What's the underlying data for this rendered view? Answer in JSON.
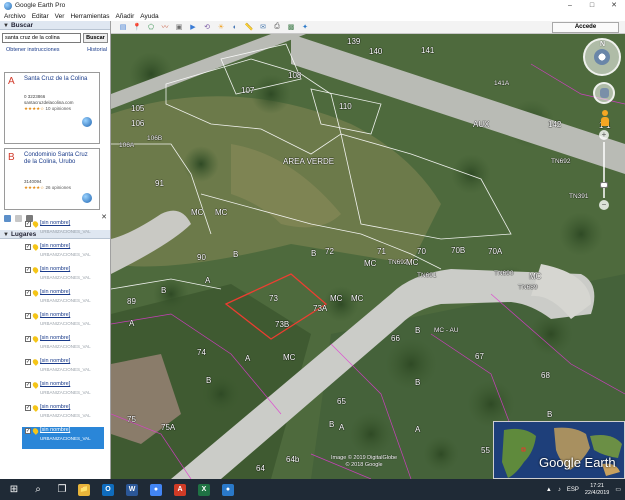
{
  "window": {
    "title": "Google Earth Pro",
    "controls": {
      "minimize": "–",
      "maximize": "□",
      "close": "✕"
    }
  },
  "menu": [
    "Archivo",
    "Editar",
    "Ver",
    "Herramientas",
    "Añadir",
    "Ayuda"
  ],
  "toolbar": {
    "tools": [
      "panel-toggle-icon",
      "placemark-icon",
      "polygon-icon",
      "path-icon",
      "overlay-icon",
      "tour-icon",
      "history-icon",
      "sun-icon",
      "planets-icon",
      "ruler-icon",
      "email-icon",
      "print-icon",
      "save-image-icon",
      "maps-icon"
    ],
    "signin_label": "Accede"
  },
  "search": {
    "section_label": "Buscar",
    "query": "santa cruz de la colina",
    "button_label": "Buscar",
    "directions_label": "Obtener instrucciones",
    "history_label": "Historial",
    "results": [
      {
        "marker": "A",
        "name": "Santa Cruz de la Colina",
        "phone": "0 3223866",
        "site": "santacruzdelacolina.com",
        "stars": "★★★★☆",
        "reviews": "10 opiniones"
      },
      {
        "marker": "B",
        "name": "Condominio Santa Cruz de la Colina, Urubo",
        "phone": "3140094",
        "stars": "★★★★☆",
        "reviews": "26 opiniones"
      }
    ]
  },
  "places": {
    "section_label": "Lugares",
    "items": [
      {
        "name": "[sin nombre]",
        "desc": "URBANIZACIONES_VAL",
        "checked": true
      },
      {
        "name": "[sin nombre]",
        "desc": "URBANIZACIONES_VAL",
        "checked": true
      },
      {
        "name": "[sin nombre]",
        "desc": "URBANIZACIONES_VAL",
        "checked": true
      },
      {
        "name": "[sin nombre]",
        "desc": "URBANIZACIONES_VAL",
        "checked": true
      },
      {
        "name": "[sin nombre]",
        "desc": "URBANIZACIONES_VAL",
        "checked": true
      },
      {
        "name": "[sin nombre]",
        "desc": "URBANIZACIONES_VAL",
        "checked": true
      },
      {
        "name": "[sin nombre]",
        "desc": "URBANIZACIONES_VAL",
        "checked": true
      },
      {
        "name": "[sin nombre]",
        "desc": "URBANIZACIONES_VAL",
        "checked": true
      },
      {
        "name": "[sin nombre]",
        "desc": "URBANIZACIONES_VAL",
        "checked": true
      },
      {
        "name": "[sin nombre]",
        "desc": "URBANIZACIONES_VAL",
        "checked": true
      }
    ]
  },
  "map": {
    "labels": [
      "139",
      "140",
      "141",
      "141A",
      "142",
      "AUX",
      "TN692",
      "TN391",
      "1-1",
      "106",
      "106A",
      "106B",
      "105",
      "108",
      "107",
      "110",
      "91",
      "AREA VERDE",
      "MC",
      "MC",
      "90",
      "B",
      "B",
      "72",
      "71",
      "70",
      "70B",
      "70A",
      "MC",
      "TN692",
      "MC",
      "TN690",
      "TN691",
      "TN689",
      "MC",
      "89",
      "A",
      "B",
      "73",
      "73A",
      "MC",
      "MC",
      "73B",
      "A",
      "A",
      "74",
      "MC",
      "66",
      "B",
      "MC - AU",
      "67",
      "68",
      "B",
      "B",
      "65",
      "B",
      "B",
      "A",
      "75",
      "75A",
      "A",
      "A",
      "64",
      "64b",
      "55"
    ],
    "attribution": [
      "Image © 2019 DigitalGlobe",
      "© 2018 Google"
    ],
    "overview_brand": "Google Earth",
    "nav_north": "N"
  },
  "taskbar": {
    "apps": [
      {
        "icon": "file-explorer-icon",
        "glyph": "📁",
        "color": "#e8b53a"
      },
      {
        "icon": "outlook-icon",
        "glyph": "O",
        "color": "#0f6cbd"
      },
      {
        "icon": "word-icon",
        "glyph": "W",
        "color": "#2b5797"
      },
      {
        "icon": "chrome-icon",
        "glyph": "●",
        "color": "#4285f4"
      },
      {
        "icon": "pdf-icon",
        "glyph": "A",
        "color": "#d03b26"
      },
      {
        "icon": "excel-icon",
        "glyph": "X",
        "color": "#1f7244"
      },
      {
        "icon": "google-earth-icon",
        "glyph": "●",
        "color": "#2a79c9"
      }
    ],
    "time": "17:21",
    "date": "22/4/2019",
    "lang": "ESP"
  }
}
